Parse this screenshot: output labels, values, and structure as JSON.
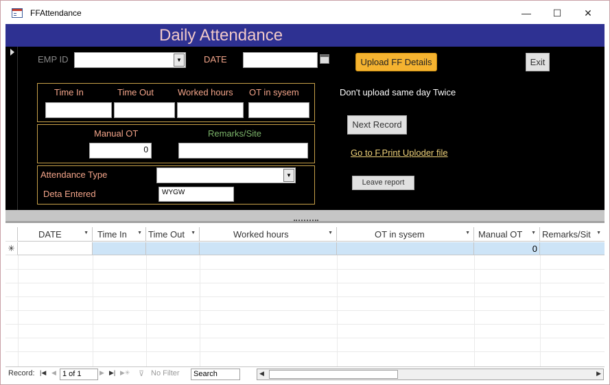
{
  "window": {
    "title": "FFAttendance",
    "minimize": "—",
    "maximize": "☐",
    "close": "✕"
  },
  "form": {
    "header_title": "Daily Attendance",
    "emp_id_label": "EMP ID",
    "emp_id_value": "",
    "date_label": "DATE",
    "date_value": "",
    "upload_button": "Upload FF Details",
    "exit_button": "Exit",
    "time_in_label": "Time In",
    "time_out_label": "Time Out",
    "worked_hours_label": "Worked hours",
    "ot_label": "OT in sysem",
    "warning_text": "Don't upload same day Twice",
    "manual_ot_label": "Manual OT",
    "manual_ot_value": "0",
    "remarks_label": "Remarks/Site",
    "next_record_button": "Next Record",
    "link_text": "Go to F.Print Uploder file",
    "attendance_type_label": "Attendance Type",
    "data_entered_label": "Deta Entered",
    "data_entered_value": "WYGW",
    "leave_report_button": "Leave report"
  },
  "grid": {
    "columns": [
      "DATE",
      "Time In",
      "Time Out",
      "Worked hours",
      "OT in sysem",
      "Manual OT",
      "Remarks/Sit"
    ],
    "new_row_marker": "✳",
    "new_row_manual_ot": "0"
  },
  "navbar": {
    "record_label": "Record:",
    "position": "1 of 1",
    "filter_label": "No Filter",
    "search_label": "Search"
  },
  "colors": {
    "header_bg": "#2e3192",
    "form_bg": "#000000",
    "accent_button": "#f5b330",
    "label_salmon": "#f4a58a",
    "label_green": "#7cb46a"
  }
}
